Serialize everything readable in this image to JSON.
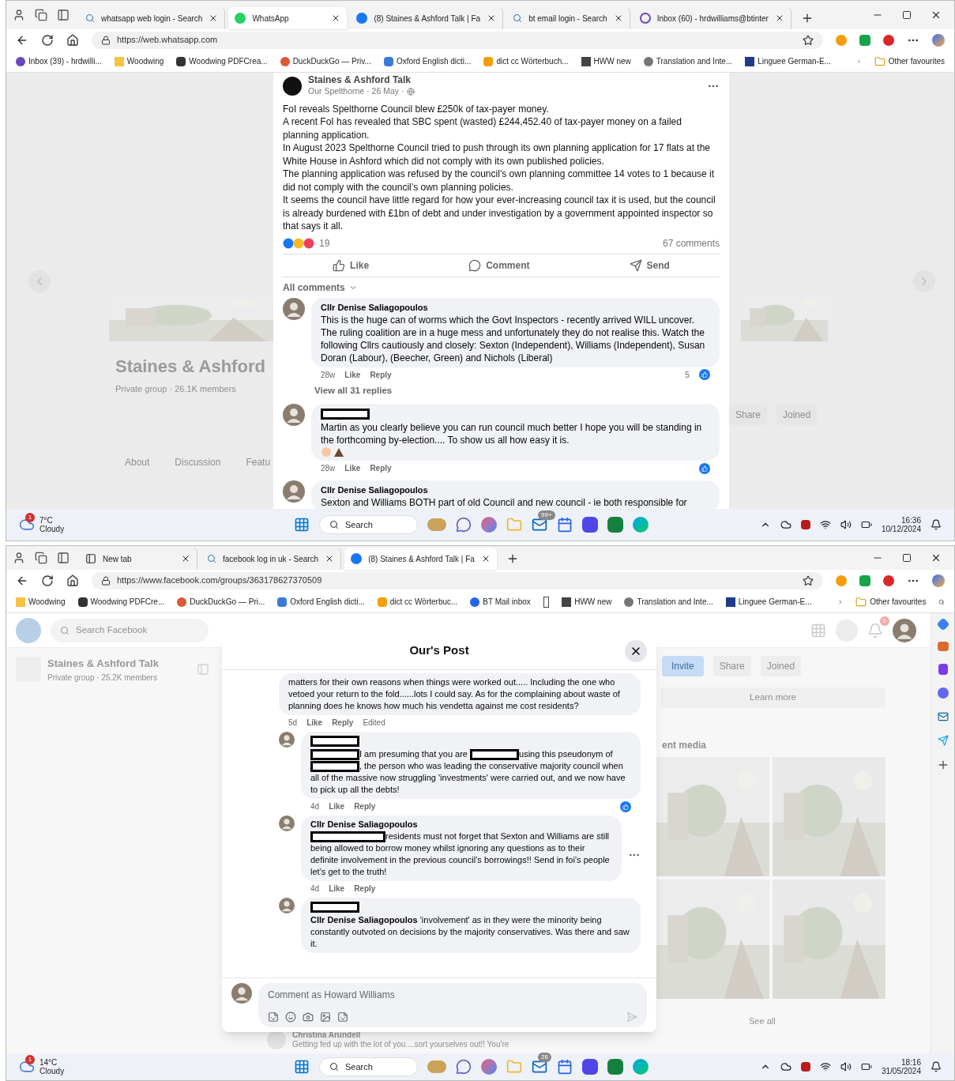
{
  "browsers": [
    {
      "tabs": [
        {
          "title": "whatsapp web login - Search",
          "selected": false
        },
        {
          "title": "WhatsApp",
          "selected": true
        },
        {
          "title": "(8) Staines & Ashford Talk | Fa",
          "selected": false
        },
        {
          "title": "bt email login - Search",
          "selected": false
        },
        {
          "title": "Inbox (60) - hrdwilliams@btinter",
          "selected": false
        }
      ],
      "url": "https://web.whatsapp.com",
      "bookmarks": [
        {
          "kind": "link",
          "label": "Inbox (39) - hrdwilli..."
        },
        {
          "kind": "link",
          "label": "Woodwing"
        },
        {
          "kind": "link",
          "label": "Woodwing PDFCrea..."
        },
        {
          "kind": "link",
          "label": "DuckDuckGo — Priv..."
        },
        {
          "kind": "link",
          "label": "Oxford English dicti..."
        },
        {
          "kind": "link",
          "label": "dict cc  Wörterbuch..."
        },
        {
          "kind": "link",
          "label": "HWW new"
        },
        {
          "kind": "link",
          "label": "Translation and Inte..."
        },
        {
          "kind": "link",
          "label": "Linguee  German-E..."
        }
      ],
      "other_favourites": "Other favourites",
      "page": {
        "kind": "post_view",
        "background": {
          "group_name": "Staines & Ashford",
          "group_meta": "Private group · 26.1K members",
          "nav": [
            "About",
            "Discussion",
            "Featu"
          ],
          "share": "Share",
          "joined": "Joined"
        },
        "post": {
          "group": "Staines & Ashford Talk",
          "meta": "Our Spelthorne · 26 May ·",
          "paragraphs": [
            "FoI reveals Spelthorne Council blew £250k of tax-payer money.",
            "A recent FoI has revealed that SBC spent (wasted) £244,452.40 of tax-payer money on a failed planning application.",
            "In August 2023 Spelthorne Council tried to push through its own planning application for 17 flats at the White House in Ashford which did not comply with its own published policies.",
            "The planning application was refused by the council’s own planning committee 14 votes to 1 because it did not comply with the council’s own planning policies.",
            "It seems the council have little regard for how your ever-increasing council tax it is used, but the council is already burdened with £1bn of debt and under investigation by a government appointed inspector so that says it all."
          ],
          "reaction_count": "19",
          "comment_count": "67 comments",
          "actions": [
            "Like",
            "Comment",
            "Send"
          ],
          "filter": "All comments",
          "comments": [
            {
              "author": {
                "kind": "name",
                "text": "Cllr Denise Saliagopoulos"
              },
              "body": [
                {
                  "kind": "text",
                  "text": "This is the huge can of worms which the Govt Inspectors - recently arrived WILL uncover. The ruling coalition are in a huge mess and unfortunately they do not realise this. Watch the following Cllrs cautiously and closely: Sexton (Independent), Williams (Independent), Susan Doran (Labour), (Beecher, Green) and Nichols (Liberal)"
                }
              ],
              "emoji": false,
              "time": "28w",
              "like": "Like",
              "reply": "Reply",
              "has_reaction": true,
              "reaction_count": "5",
              "view_replies": "View all 31 replies"
            },
            {
              "author": {
                "kind": "redaction"
              },
              "body": [
                {
                  "kind": "text",
                  "text": "Martin as you clearly believe you can run council much better I hope you will be standing in the forthcoming by-election.... To show us all how easy it is."
                }
              ],
              "emoji": true,
              "time": "28w",
              "like": "Like",
              "reply": "Reply",
              "has_reaction": true
            },
            {
              "author": {
                "kind": "name",
                "text": "Cllr Denise Saliagopoulos"
              },
              "body": [
                {
                  "kind": "text",
                  "text": "Sexton and Williams BOTH part of old Council and new council - ie both responsible for"
                }
              ]
            }
          ]
        }
      },
      "taskbar": {
        "weather_badge": "1",
        "temperature": "7°C",
        "weather": "Cloudy",
        "search": "Search",
        "mail_badge": "99+",
        "time": "16:36",
        "date": "10/12/2024"
      }
    },
    {
      "tabs": [
        {
          "title": "New tab",
          "selected": false
        },
        {
          "title": "facebook log in uk - Search",
          "selected": false
        },
        {
          "title": "(8) Staines & Ashford Talk | Fa",
          "selected": true
        }
      ],
      "url": "https://www.facebook.com/groups/363178627370509",
      "bookmarks": [
        {
          "kind": "link",
          "label": "Woodwing"
        },
        {
          "kind": "link",
          "label": "Woodwing PDFCre..."
        },
        {
          "kind": "link",
          "label": "DuckDuckGo — Pri..."
        },
        {
          "kind": "link",
          "label": "Oxford English dicti..."
        },
        {
          "kind": "link",
          "label": "dict cc  Wörterbuc..."
        },
        {
          "kind": "link",
          "label": "BT Mail inbox"
        },
        {
          "kind": "icon"
        },
        {
          "kind": "link",
          "label": "HWW new"
        },
        {
          "kind": "link",
          "label": "Translation and Inte..."
        },
        {
          "kind": "link",
          "label": "Linguee  German-E..."
        }
      ],
      "other_favourites": "Other favourites",
      "page": {
        "kind": "post_dialog",
        "background": {
          "search": "Search Facebook",
          "group_name": "Staines & Ashford Talk",
          "group_meta": "Private group · 25.2K members",
          "invite": "Invite",
          "share": "Share",
          "joined": "Joined",
          "learn_more": "Learn more",
          "media": "ent media",
          "see_all": "See all",
          "notification_badge": "6",
          "commenter": "Christina Arundell",
          "comment": "Getting fed up with the lot of you....sort yourselves out!! You're"
        },
        "dialog": {
          "title": "Our's Post",
          "composer_placeholder": "Comment as Howard Williams",
          "comments": [
            {
              "author": {
                "kind": "none"
              },
              "body": [
                {
                  "kind": "text",
                  "text": "matters for their own reasons when things were worked out..... Including the one who vetoed your return to the fold......lots I could say. As for the complaining about waste of planning does he knows how much his vendetta against me cost residents?"
                }
              ],
              "time": "5d",
              "like": "Like",
              "reply": "Reply",
              "edited": "Edited",
              "has_reaction": false,
              "more": false
            },
            {
              "author": {
                "kind": "redaction"
              },
              "body": [
                {
                  "kind": "redaction"
                },
                {
                  "kind": "text",
                  "text": "I am presuming that you are "
                },
                {
                  "kind": "redaction"
                },
                {
                  "kind": "text",
                  "text": "using this pseudonym of "
                },
                {
                  "kind": "redaction"
                },
                {
                  "kind": "text",
                  "text": ", the person who was leading the conservative majority council when all of the massive now struggling 'investments' were carried out, and we now have to pick up all the debts!"
                }
              ],
              "time": "4d",
              "like": "Like",
              "reply": "Reply",
              "has_reaction": true,
              "more": false
            },
            {
              "author": {
                "kind": "name",
                "text": "Cllr Denise Saliagopoulos"
              },
              "body": [
                {
                  "kind": "redaction"
                },
                {
                  "kind": "text",
                  "text": "residents must not forget that Sexton and Williams are still being allowed to borrow money whilst ignoring any questions as to their definite involvement in the previous council’s borrowings!! Send in foi’s people let’s get to the truth!"
                }
              ],
              "time": "4d",
              "like": "Like",
              "reply": "Reply",
              "has_reaction": false,
              "more": true
            },
            {
              "author": {
                "kind": "redaction"
              },
              "body": [
                {
                  "kind": "text",
                  "text": "**Cllr Denise Saliagopoulos** 'involvement' as in they were the minority being constantly outvoted on decisions by the majority conservatives. Was there and saw it."
                }
              ]
            }
          ]
        }
      },
      "taskbar": {
        "weather_badge": "1",
        "temperature": "14°C",
        "weather": "Cloudy",
        "search": "Search",
        "mail_badge": "26",
        "time": "18:16",
        "date": "31/05/2024"
      }
    }
  ]
}
